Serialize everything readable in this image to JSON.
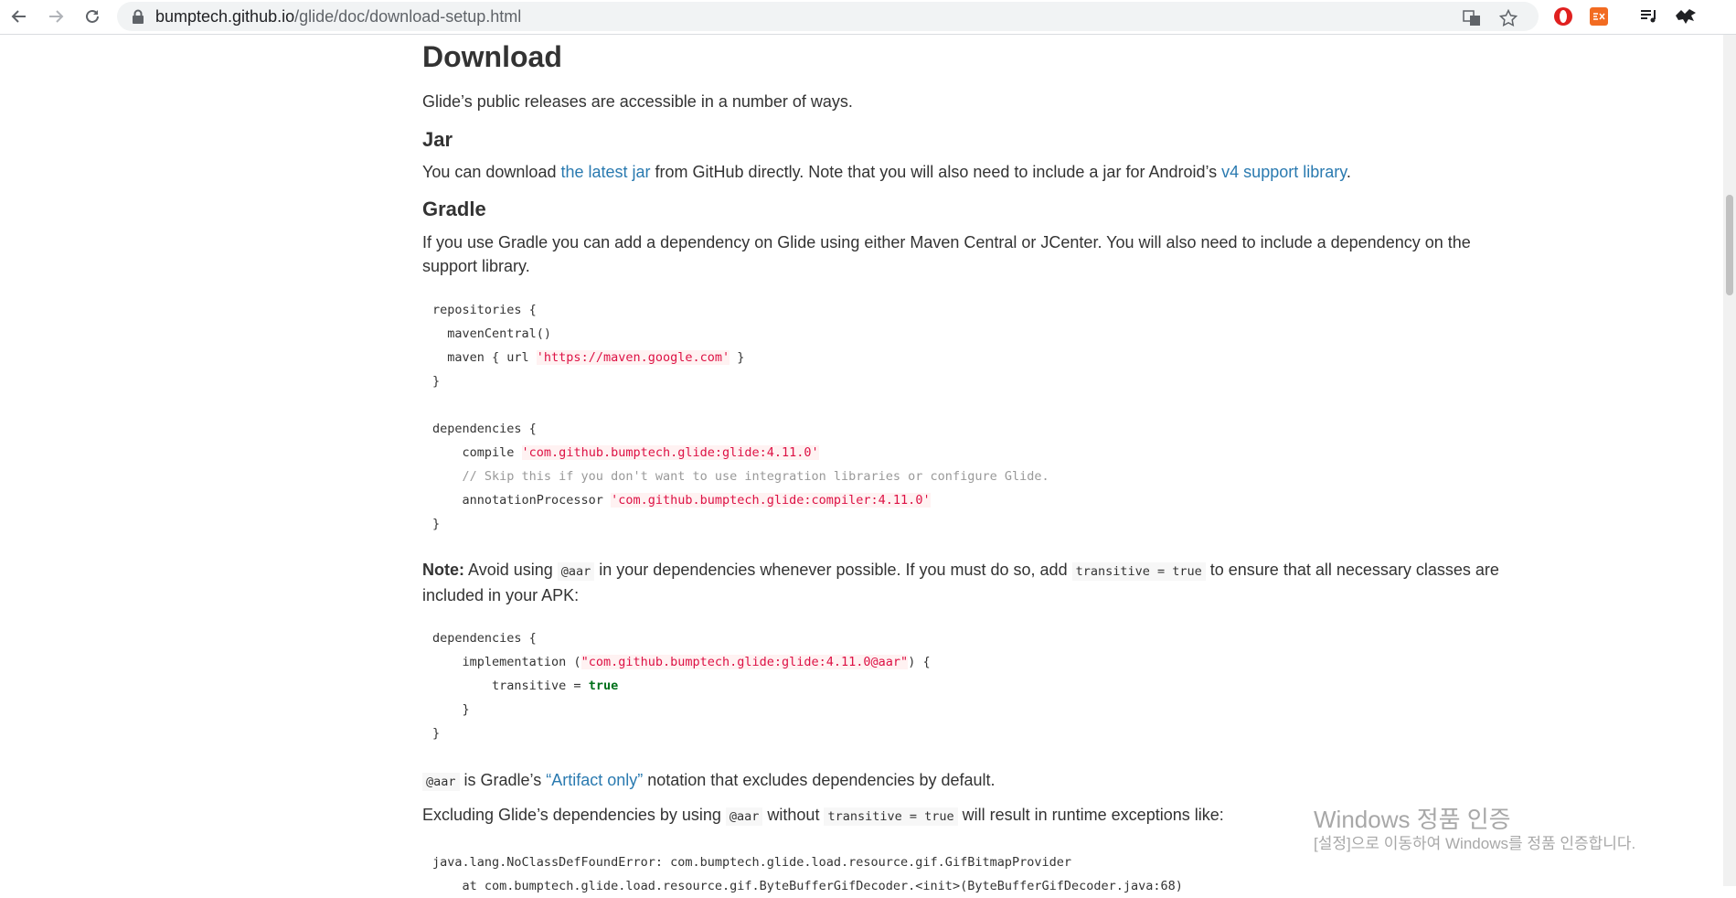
{
  "browser": {
    "url_host": "bumptech.github.io",
    "url_path": "/glide/doc/download-setup.html"
  },
  "page": {
    "title": "Download",
    "intro": "Glide’s public releases are accessible in a number of ways.",
    "jar": {
      "heading": "Jar",
      "text_before": "You can download ",
      "link1": "the latest jar",
      "text_mid": " from GitHub directly. Note that you will also need to include a jar for Android’s ",
      "link2": "v4 support library",
      "text_after": "."
    },
    "gradle": {
      "heading": "Gradle",
      "text": "If you use Gradle you can add a dependency on Glide using either Maven Central or JCenter. You will also need to include a dependency on the support library."
    },
    "code1": {
      "l1": "repositories {",
      "l2": "  mavenCentral()",
      "l3a": "  maven { url ",
      "l3s": "'https://maven.google.com'",
      "l3b": " }",
      "l4": "}",
      "l6": "dependencies {",
      "l7a": "    compile ",
      "l7s": "'com.github.bumptech.glide:glide:4.11.0'",
      "l8": "    // Skip this if you don't want to use integration libraries or configure Glide.",
      "l9a": "    annotationProcessor ",
      "l9s": "'com.github.bumptech.glide:compiler:4.11.0'",
      "l10": "}"
    },
    "note": {
      "label": "Note:",
      "t1": " Avoid using ",
      "c1": "@aar",
      "t2": " in your dependencies whenever possible. If you must do so, add ",
      "c2": "transitive = true",
      "t3": " to ensure that all necessary classes are included in your APK:"
    },
    "code2": {
      "l1": "dependencies {",
      "l2a": "    implementation (",
      "l2s": "\"com.github.bumptech.glide:glide:4.11.0@aar\"",
      "l2b": ") {",
      "l3a": "        transitive = ",
      "l3k": "true",
      "l4": "    }",
      "l5": "}"
    },
    "aar_line": {
      "c1": "@aar",
      "t1": " is Gradle’s ",
      "link": "“Artifact only”",
      "t2": " notation that excludes dependencies by default."
    },
    "excl_line": {
      "t1": "Excluding Glide’s dependencies by using ",
      "c1": "@aar",
      "t2": " without ",
      "c2": "transitive = true",
      "t3": " will result in runtime exceptions like:"
    },
    "code3": {
      "l1": "java.lang.NoClassDefFoundError: com.bumptech.glide.load.resource.gif.GifBitmapProvider",
      "l2": "    at com.bumptech.glide.load.resource.gif.ByteBufferGifDecoder.<init>(ByteBufferGifDecoder.java:68)"
    }
  },
  "watermark": {
    "line1": "Windows 정품 인증",
    "line2": "[설정]으로 이동하여 Windows를 정품 인증합니다."
  },
  "icons": {
    "back": "back-arrow-icon",
    "forward": "forward-arrow-icon",
    "reload": "reload-icon",
    "lock": "lock-icon",
    "translate": "translate-icon",
    "bookmark": "star-icon"
  },
  "colors": {
    "link": "#2a7ab0",
    "string": "#dd1144",
    "keyword": "#00701a"
  }
}
